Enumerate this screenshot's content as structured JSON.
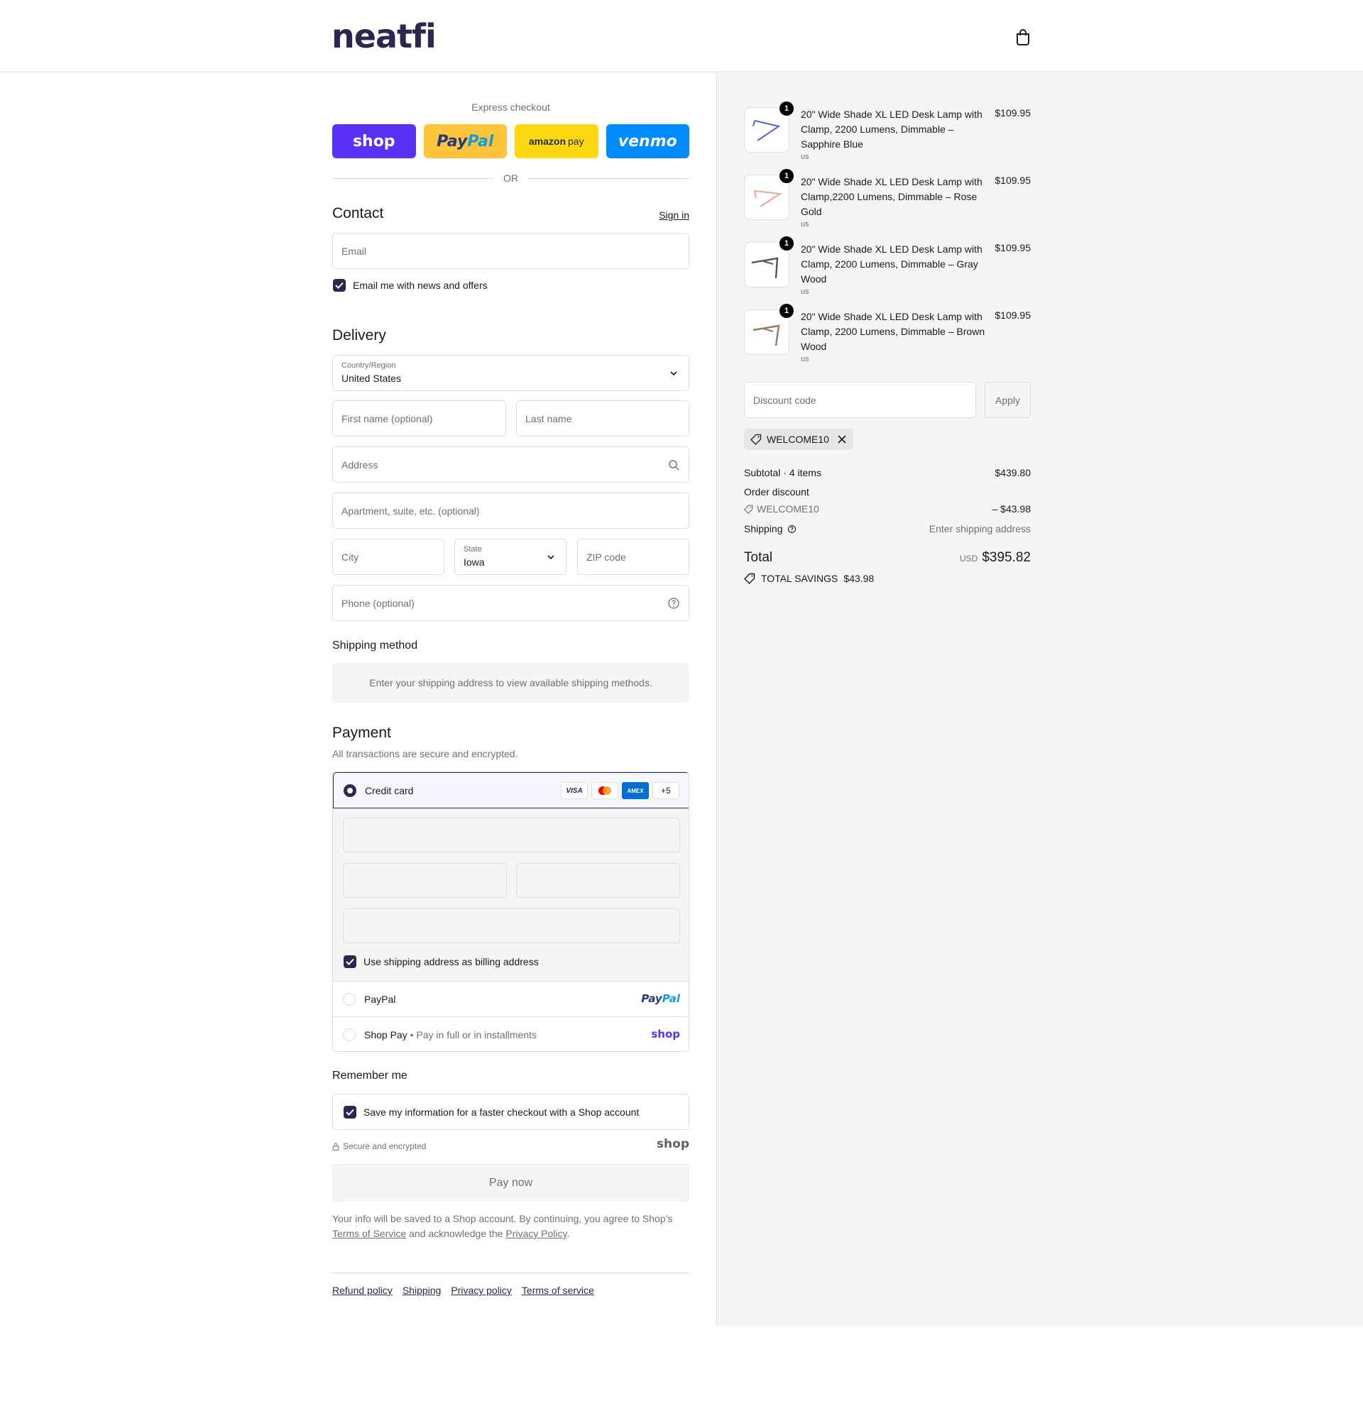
{
  "brand": {
    "logo_text": "neatfi",
    "cart_icon": "shopping-bag-icon"
  },
  "express": {
    "title": "Express checkout",
    "buttons": {
      "shop": "shop",
      "paypal_a": "Pay",
      "paypal_b": "Pal",
      "amazon_a": "amazon",
      "amazon_b": "pay",
      "venmo": "venmo"
    },
    "or": "OR"
  },
  "contact": {
    "title": "Contact",
    "sign_in": "Sign in",
    "email_placeholder": "Email",
    "newsletter_label": "Email me with news and offers",
    "newsletter_checked": true
  },
  "delivery": {
    "title": "Delivery",
    "country_label": "Country/Region",
    "country_value": "United States",
    "first_name_placeholder": "First name (optional)",
    "last_name_placeholder": "Last name",
    "address_placeholder": "Address",
    "apartment_placeholder": "Apartment, suite, etc. (optional)",
    "city_placeholder": "City",
    "state_label": "State",
    "state_value": "Iowa",
    "zip_placeholder": "ZIP code",
    "phone_placeholder": "Phone (optional)"
  },
  "shipping_method": {
    "title": "Shipping method",
    "note": "Enter your shipping address to view available shipping methods."
  },
  "payment": {
    "title": "Payment",
    "subtitle": "All transactions are secure and encrypted.",
    "credit_card_label": "Credit card",
    "card_brands": {
      "visa": "VISA",
      "amex": "AMEX",
      "more": "+5"
    },
    "billing_label": "Use shipping address as billing address",
    "paypal_label": "PayPal",
    "paypal_logo_a": "Pay",
    "paypal_logo_b": "Pal",
    "shoppay_label": "Shop Pay",
    "shoppay_note": "Pay in full or in installments",
    "shoppay_logo": "shop"
  },
  "remember": {
    "title": "Remember me",
    "save_label": "Save my information for a faster checkout with a Shop account",
    "secure_text": "Secure and encrypted",
    "shop_logo": "shop"
  },
  "pay_now": "Pay now",
  "legal": {
    "text_1": "Your info will be saved to a Shop account. By continuing, you agree to Shop’s",
    "terms": "Terms of Service",
    "text_2": "and acknowledge the",
    "privacy": "Privacy Policy",
    "text_3": "."
  },
  "footer": [
    "Refund policy",
    "Shipping",
    "Privacy policy",
    "Terms of service"
  ],
  "cart_items": [
    {
      "qty": "1",
      "title": "20\" Wide Shade XL LED Desk Lamp with Clamp, 2200 Lumens, Dimmable – Sapphire Blue",
      "sub": "us",
      "price": "$109.95",
      "color": "#5a5fd8"
    },
    {
      "qty": "1",
      "title": "20\" Wide Shade XL LED Desk Lamp with Clamp,2200 Lumens, Dimmable – Rose Gold",
      "sub": "us",
      "price": "$109.95",
      "color": "#e9a49a"
    },
    {
      "qty": "1",
      "title": "20\" Wide Shade XL LED Desk Lamp with Clamp, 2200 Lumens, Dimmable – Gray Wood",
      "sub": "us",
      "price": "$109.95",
      "color": "#555a66"
    },
    {
      "qty": "1",
      "title": "20\" Wide Shade XL LED Desk Lamp with Clamp, 2200 Lumens, Dimmable – Brown Wood",
      "sub": "us",
      "price": "$109.95",
      "color": "#9a7a60"
    }
  ],
  "discount": {
    "placeholder": "Discount code",
    "apply": "Apply",
    "applied_code": "WELCOME10"
  },
  "totals": {
    "subtotal_label": "Subtotal · 4 items",
    "subtotal_value": "$439.80",
    "order_discount_label": "Order discount",
    "discount_code": "WELCOME10",
    "discount_value": "– $43.98",
    "shipping_label": "Shipping",
    "shipping_value": "Enter shipping address",
    "total_label": "Total",
    "currency": "USD",
    "total_value": "$395.82",
    "savings_label": "TOTAL SAVINGS",
    "savings_value": "$43.98"
  }
}
